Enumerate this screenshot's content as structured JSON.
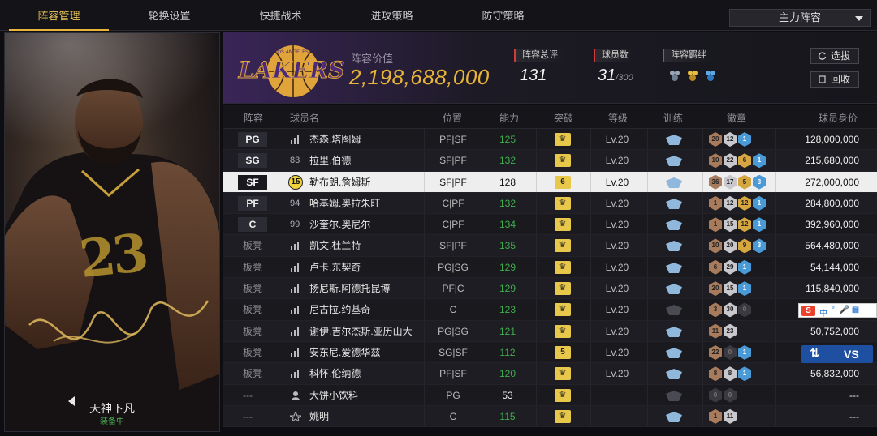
{
  "nav": {
    "tabs": [
      "阵容管理",
      "轮换设置",
      "快捷战术",
      "进攻策略",
      "防守策略"
    ],
    "active_index": 0,
    "lineup_select": "主力阵容"
  },
  "card": {
    "player_name": "天神下凡",
    "equipped_label": "装备中",
    "jersey": "23"
  },
  "team": {
    "logo_text": "LAKERS",
    "logo_top_text": "LOS ANGELES",
    "value_label": "阵容价值",
    "value": "2,198,688,000",
    "rating_label": "阵容总评",
    "rating": "131",
    "count_label": "球员数",
    "count": "31",
    "count_max": "/300",
    "bond_label": "阵容羁绊",
    "btn_draft": "选拔",
    "btn_recycle": "回收"
  },
  "table": {
    "headers": [
      "阵容",
      "球员名",
      "位置",
      "能力",
      "突破",
      "等级",
      "训练",
      "徽章",
      "球员身价"
    ],
    "rows": [
      {
        "slot": "PG",
        "num": "",
        "name": "杰森.塔图姆",
        "pos": "PF|SF",
        "rating": "125",
        "brk": "",
        "level": "Lv.20",
        "badges": [
          [
            "b-bronze",
            "20"
          ],
          [
            "b-silver",
            "12"
          ],
          [
            "b-blue",
            "1"
          ]
        ],
        "salary": "128,000,000"
      },
      {
        "slot": "SG",
        "num": "83",
        "name": "拉里.伯德",
        "pos": "SF|PF",
        "rating": "132",
        "brk": "",
        "level": "Lv.20",
        "badges": [
          [
            "b-bronze",
            "10"
          ],
          [
            "b-silver",
            "22"
          ],
          [
            "b-gold",
            "6"
          ],
          [
            "b-blue",
            "1"
          ]
        ],
        "salary": "215,680,000"
      },
      {
        "slot": "SF",
        "num": "15",
        "name": "勒布朗.詹姆斯",
        "pos": "SF|PF",
        "rating": "128",
        "brk": "6",
        "level": "Lv.20",
        "badges": [
          [
            "b-bronze",
            "36"
          ],
          [
            "b-silver",
            "17"
          ],
          [
            "b-gold",
            "5"
          ],
          [
            "b-blue",
            "3"
          ]
        ],
        "salary": "272,000,000"
      },
      {
        "slot": "PF",
        "num": "94",
        "name": "哈基姆.奥拉朱旺",
        "pos": "C|PF",
        "rating": "132",
        "brk": "",
        "level": "Lv.20",
        "badges": [
          [
            "b-bronze",
            "1"
          ],
          [
            "b-silver",
            "12"
          ],
          [
            "b-gold",
            "12"
          ],
          [
            "b-blue",
            "1"
          ]
        ],
        "salary": "284,800,000"
      },
      {
        "slot": "C",
        "num": "99",
        "name": "沙奎尔.奥尼尔",
        "pos": "C|PF",
        "rating": "134",
        "brk": "",
        "level": "Lv.20",
        "badges": [
          [
            "b-bronze",
            "1"
          ],
          [
            "b-silver",
            "15"
          ],
          [
            "b-gold",
            "12"
          ],
          [
            "b-blue",
            "1"
          ]
        ],
        "salary": "392,960,000"
      },
      {
        "slot": "板凳",
        "num": "",
        "name": "凯文.杜兰特",
        "pos": "SF|PF",
        "rating": "135",
        "brk": "",
        "level": "Lv.20",
        "badges": [
          [
            "b-bronze",
            "10"
          ],
          [
            "b-silver",
            "20"
          ],
          [
            "b-gold",
            "9"
          ],
          [
            "b-blue",
            "3"
          ]
        ],
        "salary": "564,480,000"
      },
      {
        "slot": "板凳",
        "num": "",
        "name": "卢卡.东契奇",
        "pos": "PG|SG",
        "rating": "129",
        "brk": "",
        "level": "Lv.20",
        "badges": [
          [
            "b-bronze",
            "6"
          ],
          [
            "b-silver",
            "29"
          ],
          [
            "b-blue",
            "1"
          ]
        ],
        "salary": "54,144,000"
      },
      {
        "slot": "板凳",
        "num": "",
        "name": "扬尼斯.阿德托昆博",
        "pos": "PF|C",
        "rating": "129",
        "brk": "",
        "level": "Lv.20",
        "badges": [
          [
            "b-bronze",
            "20"
          ],
          [
            "b-silver",
            "15"
          ],
          [
            "b-blue",
            "1"
          ]
        ],
        "salary": "115,840,000"
      },
      {
        "slot": "板凳",
        "num": "",
        "name": "尼古拉.约基奇",
        "pos": "C",
        "rating": "123",
        "brk": "",
        "level": "Lv.20",
        "badges": [
          [
            "b-bronze",
            "3"
          ],
          [
            "b-silver",
            "30"
          ],
          [
            "b-dark",
            "0"
          ]
        ],
        "salary": ""
      },
      {
        "slot": "板凳",
        "num": "",
        "name": "谢伊.吉尔杰斯.亚历山大",
        "pos": "PG|SG",
        "rating": "121",
        "brk": "",
        "level": "Lv.20",
        "badges": [
          [
            "b-bronze",
            "11"
          ],
          [
            "b-silver",
            "23"
          ]
        ],
        "salary": "50,752,000"
      },
      {
        "slot": "板凳",
        "num": "",
        "name": "安东尼.爱德华兹",
        "pos": "SG|SF",
        "rating": "112",
        "brk": "5",
        "level": "Lv.20",
        "badges": [
          [
            "b-bronze",
            "22"
          ],
          [
            "b-dark",
            "0"
          ],
          [
            "b-blue",
            "1"
          ]
        ],
        "salary": ""
      },
      {
        "slot": "板凳",
        "num": "",
        "name": "科怀.伦纳德",
        "pos": "PF|SF",
        "rating": "120",
        "brk": "",
        "level": "Lv.20",
        "badges": [
          [
            "b-bronze",
            "8"
          ],
          [
            "b-silver",
            "8"
          ],
          [
            "b-blue",
            "1"
          ]
        ],
        "salary": "56,832,000"
      },
      {
        "slot": "---",
        "num": "",
        "name": "大饼小饮料",
        "pos": "PG",
        "rating": "53",
        "brk": "",
        "level": "",
        "badges": [
          [
            "b-dark",
            "0"
          ],
          [
            "b-dark",
            "0"
          ]
        ],
        "salary": "---"
      },
      {
        "slot": "---",
        "num": "",
        "name": "姚明",
        "pos": "C",
        "rating": "115",
        "brk": "",
        "level": "",
        "badges": [
          [
            "b-bronze",
            "1"
          ],
          [
            "b-silver",
            "11"
          ]
        ],
        "salary": "---"
      }
    ]
  },
  "widgets": {
    "ime_zh": "中",
    "vs_label": "VS"
  }
}
